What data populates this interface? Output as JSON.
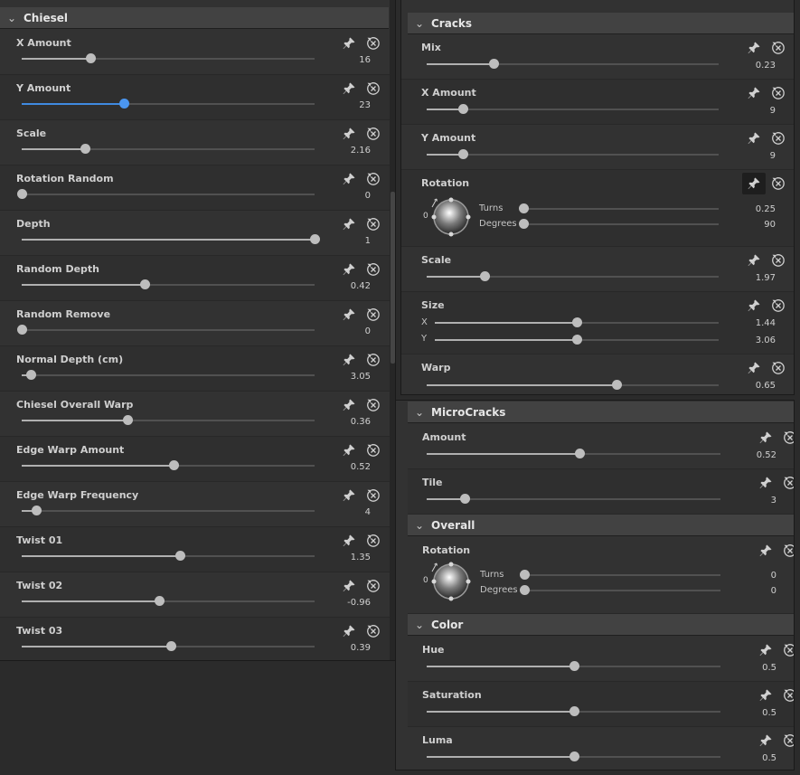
{
  "chiesel": {
    "title": "Chiesel",
    "rows": [
      {
        "label": "X Amount",
        "value": "16",
        "pos": 0.235
      },
      {
        "label": "Y Amount",
        "value": "23",
        "pos": 0.35,
        "active": true
      },
      {
        "label": "Scale",
        "value": "2.16",
        "pos": 0.215
      },
      {
        "label": "Rotation Random",
        "value": "0",
        "pos": 0.0
      },
      {
        "label": "Depth",
        "value": "1",
        "pos": 1.0
      },
      {
        "label": "Random Depth",
        "value": "0.42",
        "pos": 0.42
      },
      {
        "label": "Random Remove",
        "value": "0",
        "pos": 0.0
      },
      {
        "label": "Normal Depth (cm)",
        "value": "3.05",
        "pos": 0.03
      },
      {
        "label": "Chiesel Overall Warp",
        "value": "0.36",
        "pos": 0.36
      },
      {
        "label": "Edge Warp Amount",
        "value": "0.52",
        "pos": 0.52
      },
      {
        "label": "Edge Warp Frequency",
        "value": "4",
        "pos": 0.05
      },
      {
        "label": "Twist 01",
        "value": "1.35",
        "pos": 0.54
      },
      {
        "label": "Twist 02",
        "value": "-0.96",
        "pos": 0.47
      },
      {
        "label": "Twist 03",
        "value": "0.39",
        "pos": 0.51
      }
    ]
  },
  "cracks": {
    "title": "Cracks",
    "mix": {
      "label": "Mix",
      "value": "0.23",
      "pos": 0.23
    },
    "x_amount": {
      "label": "X Amount",
      "value": "9",
      "pos": 0.125
    },
    "y_amount": {
      "label": "Y Amount",
      "value": "9",
      "pos": 0.125
    },
    "rotation": {
      "label": "Rotation",
      "zero_label": "0",
      "turns_label": "Turns",
      "turns_value": "0.25",
      "turns_pos": 0.0,
      "degrees_label": "Degrees",
      "degrees_value": "90",
      "degrees_pos": 0.0
    },
    "scale": {
      "label": "Scale",
      "value": "1.97",
      "pos": 0.197
    },
    "size": {
      "label": "Size",
      "x_label": "X",
      "x_value": "1.44",
      "x_pos": 0.5,
      "y_label": "Y",
      "y_value": "3.06",
      "y_pos": 0.5
    },
    "warp": {
      "label": "Warp",
      "value": "0.65",
      "pos": 0.65
    }
  },
  "microcracks": {
    "title": "MicroCracks",
    "amount": {
      "label": "Amount",
      "value": "0.52",
      "pos": 0.52
    },
    "tile": {
      "label": "Tile",
      "value": "3",
      "pos": 0.13
    }
  },
  "overall": {
    "title": "Overall",
    "rotation": {
      "label": "Rotation",
      "zero_label": "0",
      "turns_label": "Turns",
      "turns_value": "0",
      "turns_pos": 0.0,
      "degrees_label": "Degrees",
      "degrees_value": "0",
      "degrees_pos": 0.0
    }
  },
  "color": {
    "title": "Color",
    "hue": {
      "label": "Hue",
      "value": "0.5",
      "pos": 0.5
    },
    "saturation": {
      "label": "Saturation",
      "value": "0.5",
      "pos": 0.5
    },
    "luma": {
      "label": "Luma",
      "value": "0.5",
      "pos": 0.5
    }
  },
  "icons": {
    "pin": "pin-icon",
    "reset": "reset-icon",
    "collapse": "chevron-down-icon"
  },
  "colors": {
    "accent": "#4b96f0",
    "panel": "#323232",
    "header": "#424242"
  }
}
